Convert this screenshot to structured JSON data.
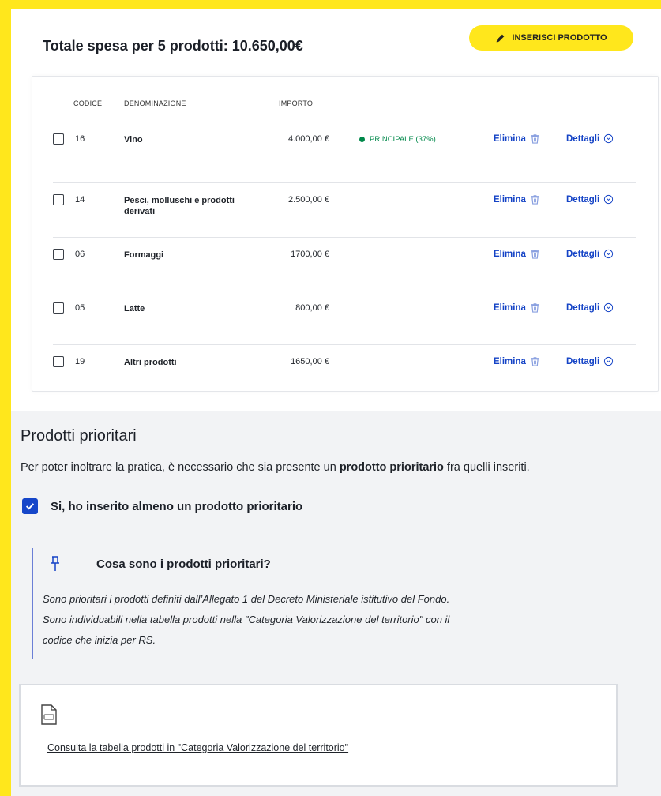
{
  "header": {
    "total_label": "Totale spesa per 5 prodotti: 10.650,00€",
    "add_button_label": "INSERISCI PRODOTTO"
  },
  "table": {
    "columns": [
      "CODICE",
      "DENOMINAZIONE",
      "IMPORTO"
    ],
    "rows": [
      {
        "code": "16",
        "name": "Vino",
        "amount": "4.000,00 €",
        "badge": "PRINCIPALE (37%)",
        "delete": "Elimina",
        "details": "Dettagli"
      },
      {
        "code": "14",
        "name": "Pesci, molluschi e prodotti derivati",
        "amount": "2.500,00 €",
        "badge": "",
        "delete": "Elimina",
        "details": "Dettagli"
      },
      {
        "code": "06",
        "name": "Formaggi",
        "amount": "1700,00 €",
        "badge": "",
        "delete": "Elimina",
        "details": "Dettagli"
      },
      {
        "code": "05",
        "name": "Latte",
        "amount": "800,00 €",
        "badge": "",
        "delete": "Elimina",
        "details": "Dettagli"
      },
      {
        "code": "19",
        "name": "Altri prodotti",
        "amount": "1650,00 €",
        "badge": "",
        "delete": "Elimina",
        "details": "Dettagli"
      }
    ]
  },
  "priority": {
    "title": "Prodotti prioritari",
    "desc_before": "Per poter inoltrare la pratica, è necessario che sia presente un ",
    "desc_bold": "prodotto prioritario",
    "desc_after": " fra quelli inseriti.",
    "checkbox_label": "Si, ho inserito almeno un prodotto prioritario",
    "checkbox_checked": true
  },
  "info": {
    "heading": "Cosa sono i prodotti prioritari?",
    "line1": "Sono prioritari i prodotti definiti dall’Allegato 1 del Decreto Ministeriale istitutivo del Fondo.",
    "line2": "Sono individuabili nella tabella prodotti nella \"Categoria Valorizzazione del territorio\" con il",
    "line3": "codice che inizia per RS."
  },
  "document": {
    "link_text": "Consulta la tabella prodotti in \"Categoria Valorizzazione del territorio\""
  },
  "colors": {
    "accent_yellow": "#ffe71c",
    "link_blue": "#1443c6",
    "success_green": "#00884a"
  }
}
